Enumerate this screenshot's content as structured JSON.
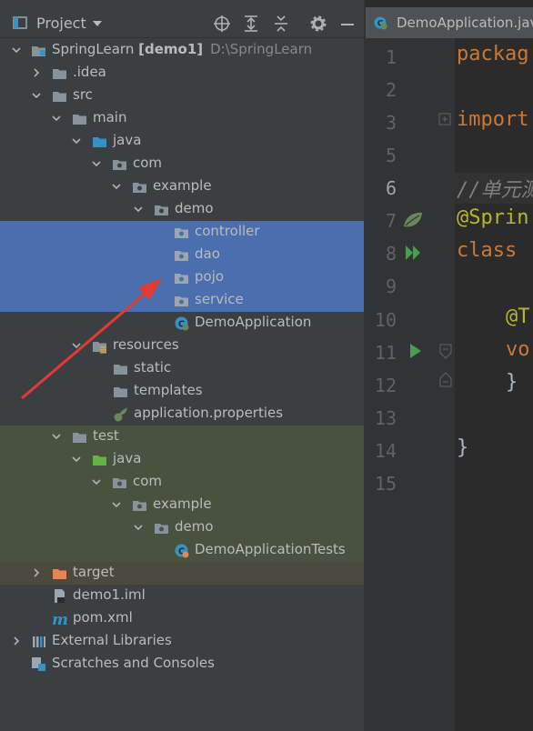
{
  "project_panel": {
    "title": "Project",
    "tree": [
      {
        "label": "SpringLearn",
        "bold_suffix": "[demo1]",
        "extra": "D:\\SpringLearn"
      },
      {
        "label": ".idea"
      },
      {
        "label": "src"
      },
      {
        "label": "main"
      },
      {
        "label": "java"
      },
      {
        "label": "com"
      },
      {
        "label": "example"
      },
      {
        "label": "demo"
      },
      {
        "label": "controller"
      },
      {
        "label": "dao"
      },
      {
        "label": "pojo"
      },
      {
        "label": "service"
      },
      {
        "label": "DemoApplication"
      },
      {
        "label": "resources"
      },
      {
        "label": "static"
      },
      {
        "label": "templates"
      },
      {
        "label": "application.properties"
      },
      {
        "label": "test"
      },
      {
        "label": "java"
      },
      {
        "label": "com"
      },
      {
        "label": "example"
      },
      {
        "label": "demo"
      },
      {
        "label": "DemoApplicationTests"
      },
      {
        "label": "target"
      },
      {
        "label": "demo1.iml"
      },
      {
        "label": "pom.xml"
      },
      {
        "label": "External Libraries"
      },
      {
        "label": "Scratches and Consoles"
      }
    ]
  },
  "editor": {
    "tab_label": "DemoApplication.java",
    "line_numbers": [
      "1",
      "2",
      "3",
      "5",
      "6",
      "7",
      "8",
      "9",
      "10",
      "11",
      "12",
      "13",
      "14",
      "15"
    ],
    "code": {
      "l1": "packag",
      "l3": "import",
      "l6": "//单元测",
      "l7": "@Sprin",
      "l8": "class",
      "l10": "@T",
      "l11": "vo",
      "l12": "}",
      "l14": "}"
    }
  },
  "colors": {
    "selection": "#4b6eaf",
    "test_bg": "#49523f",
    "target_bg": "#4c4a3c",
    "annotation_arrow": "#e53935"
  }
}
